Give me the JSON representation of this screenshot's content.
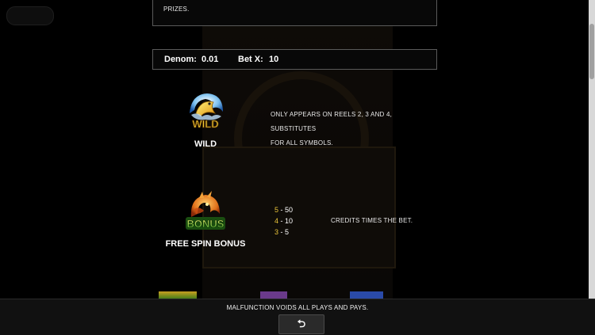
{
  "header": {
    "prizes_text": "PRIZES."
  },
  "bet_info": {
    "denom_label": "Denom",
    "denom_sep": ":",
    "denom_value": "0.01",
    "betx_label": "Bet X",
    "betx_sep": ":",
    "betx_value": "10"
  },
  "symbols": {
    "wild": {
      "icon_text": "WILD",
      "name": "WILD",
      "description_line1": "ONLY APPEARS ON REELS 2, 3 AND 4, SUBSTITUTES",
      "description_line2": "FOR ALL SYMBOLS."
    },
    "bonus": {
      "icon_text": "BONUS",
      "name": "FREE SPIN BONUS",
      "pays": [
        {
          "count": "5",
          "sep": " - ",
          "value": "50"
        },
        {
          "count": "4",
          "sep": " - ",
          "value": "10"
        },
        {
          "count": "3",
          "sep": " - ",
          "value": "5"
        }
      ],
      "pay_note": "CREDITS TIMES THE BET."
    }
  },
  "footer": {
    "malfunction_notice": "MALFUNCTION VOIDS ALL PLAYS AND PAYS.",
    "back_icon": "return-arrow-icon",
    "back_glyph": "⮌"
  },
  "colors": {
    "background": "#000000",
    "panel_border": "#5a5a5a",
    "pay_count": "#e8c33a",
    "text": "#ffffff"
  }
}
